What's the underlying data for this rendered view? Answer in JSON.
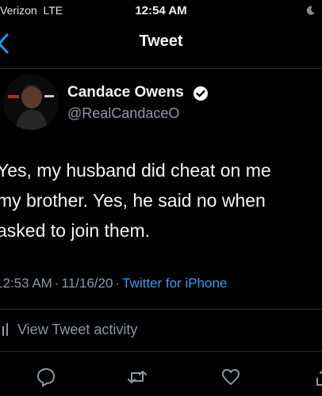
{
  "status_bar": {
    "carrier": "Verizon",
    "network": "LTE",
    "time": "12:54 AM"
  },
  "nav": {
    "title": "Tweet",
    "back_icon": "chevron-left-icon"
  },
  "author": {
    "name": "Candace Owens",
    "handle": "@RealCandaceO",
    "verified": true
  },
  "tweet": {
    "lines": [
      "Yes, my husband did cheat on me",
      "my brother. Yes, he said no when",
      "asked to join them."
    ],
    "time": "12:53 AM",
    "date": "11/16/20",
    "separator": "·",
    "source": "Twitter for iPhone"
  },
  "activity": {
    "label": "View Tweet activity"
  },
  "actions": [
    "reply-icon",
    "retweet-icon",
    "like-icon",
    "share-icon"
  ],
  "colors": {
    "background": "#000000",
    "secondary_text": "#8b98a5",
    "link": "#3a9be9",
    "verified": "#ffffff"
  }
}
